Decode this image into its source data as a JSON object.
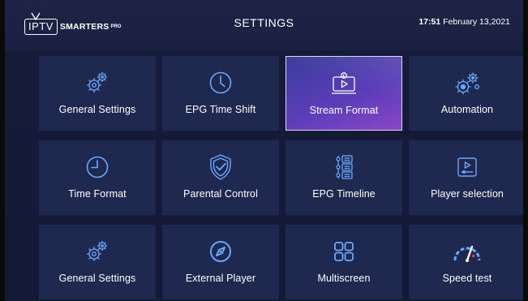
{
  "header": {
    "logo": {
      "boxed": "IPTV",
      "text": "SMARTERS",
      "suffix": "PRO"
    },
    "title": "SETTINGS",
    "clock": {
      "time": "17:51",
      "date": "February 13,2021"
    }
  },
  "tiles": [
    {
      "label": "General Settings",
      "icon": "gears-icon"
    },
    {
      "label": "EPG Time Shift",
      "icon": "clock-icon"
    },
    {
      "label": "Stream Format",
      "icon": "tv-play-icon",
      "selected": true
    },
    {
      "label": "Automation",
      "icon": "automation-gears-icon"
    },
    {
      "label": "Time Format",
      "icon": "clock-icon"
    },
    {
      "label": "Parental  Control",
      "icon": "shield-check-icon"
    },
    {
      "label": "EPG Timeline",
      "icon": "timeline-list-icon"
    },
    {
      "label": "Player selection",
      "icon": "player-icon"
    },
    {
      "label": "General Settings",
      "icon": "gears-icon"
    },
    {
      "label": "External Player",
      "icon": "compass-icon"
    },
    {
      "label": "Multiscreen",
      "icon": "multiscreen-icon"
    },
    {
      "label": "Speed test",
      "icon": "speedometer-icon"
    }
  ],
  "colors": {
    "background": "#141a36",
    "tile": "#1f2950",
    "selected_start": "#3b3d9a",
    "selected_end": "#8a46c9",
    "accent": "#6aa8ff"
  }
}
